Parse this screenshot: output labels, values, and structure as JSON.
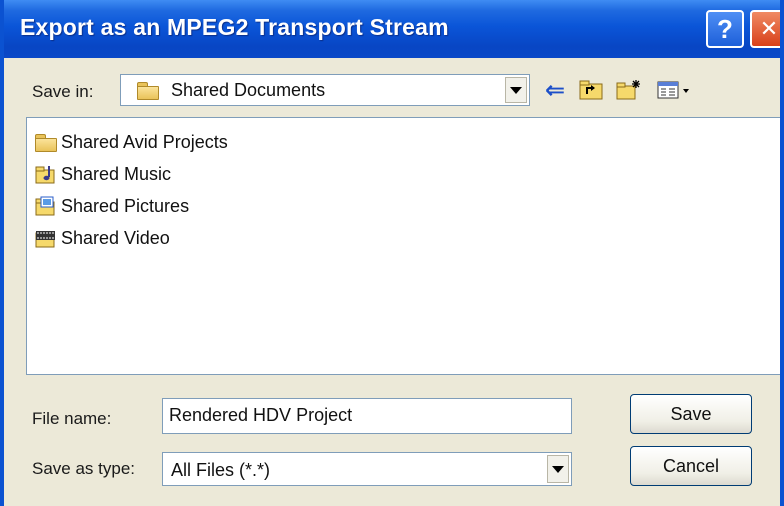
{
  "window": {
    "title": "Export as an MPEG2 Transport Stream",
    "help_glyph": "?",
    "close_glyph": "✕"
  },
  "save_in": {
    "label": "Save in:",
    "value": "Shared Documents"
  },
  "toolbar": {
    "back_glyph": "⇐",
    "icons": [
      "back-arrow-icon",
      "up-folder-icon",
      "new-folder-icon",
      "view-menu-icon"
    ]
  },
  "files": [
    {
      "name": "Shared Avid Projects",
      "icon": "folder-icon"
    },
    {
      "name": "Shared Music",
      "icon": "music-folder-icon"
    },
    {
      "name": "Shared Pictures",
      "icon": "pictures-folder-icon"
    },
    {
      "name": "Shared Video",
      "icon": "video-folder-icon"
    }
  ],
  "file_name": {
    "label": "File name:",
    "value": "Rendered HDV Project"
  },
  "save_as_type": {
    "label": "Save as type:",
    "value": "All Files (*.*)"
  },
  "buttons": {
    "save": "Save",
    "cancel": "Cancel"
  },
  "colors": {
    "titlebar": "#0a55d8",
    "dialog_bg": "#ece9d8",
    "close_button": "#d8401a"
  }
}
